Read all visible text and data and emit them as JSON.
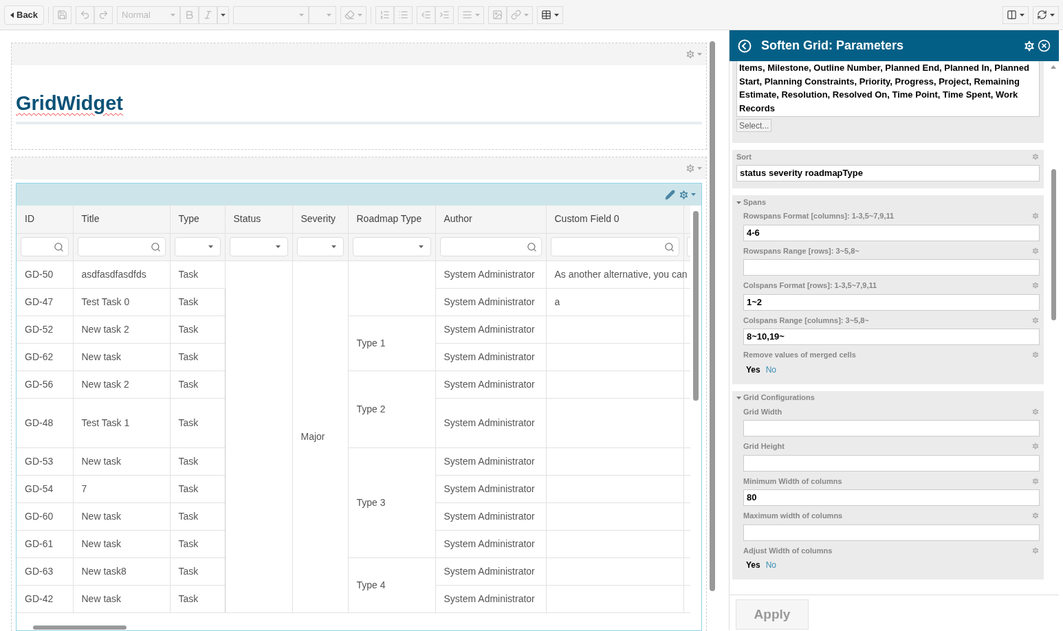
{
  "toolbar": {
    "back": "Back",
    "style": "Normal",
    "formatting_disabled": true
  },
  "title_widget": {
    "title": "GridWidget"
  },
  "grid": {
    "columns": [
      {
        "label": "ID",
        "kind": "search"
      },
      {
        "label": "Title",
        "kind": "search"
      },
      {
        "label": "Type",
        "kind": "select"
      },
      {
        "label": "Status",
        "kind": "select"
      },
      {
        "label": "Severity",
        "kind": "select"
      },
      {
        "label": "Roadmap Type",
        "kind": "select"
      },
      {
        "label": "Author",
        "kind": "search"
      },
      {
        "label": "Custom Field 0",
        "kind": "search"
      }
    ],
    "severity": "Major",
    "roadmap_groups": [
      {
        "rows": [
          {
            "id": "GD-50",
            "title": "asdfasdfasdfds",
            "type": "Task",
            "author": "System Administrator",
            "custom_field": "As another alternative, you can"
          },
          {
            "id": "GD-47",
            "title": "Test Task 0",
            "type": "Task",
            "author": "System Administrator",
            "custom_field": "a"
          }
        ]
      },
      {
        "roadmap_type": "Type 1",
        "rows": [
          {
            "id": "GD-52",
            "title": "New task 2",
            "type": "Task",
            "author": "System Administrator"
          },
          {
            "id": "GD-62",
            "title": "New task",
            "type": "Task",
            "author": "System Administrator"
          }
        ]
      },
      {
        "roadmap_type": "Type 2",
        "rows": [
          {
            "id": "GD-56",
            "title": "New task 2",
            "type": "Task",
            "author": "System Administrator"
          },
          {
            "id": "GD-48",
            "title": "Test Task 1",
            "type": "Task",
            "author": "System Administrator",
            "tall": true
          }
        ]
      },
      {
        "roadmap_type": "Type 3",
        "rows": [
          {
            "id": "GD-53",
            "title": "New task",
            "type": "Task",
            "author": "System Administrator"
          },
          {
            "id": "GD-54",
            "title": "7",
            "type": "Task",
            "author": "System Administrator"
          },
          {
            "id": "GD-60",
            "title": "New task",
            "type": "Task",
            "author": "System Administrator"
          },
          {
            "id": "GD-61",
            "title": "New task",
            "type": "Task",
            "author": "System Administrator"
          }
        ]
      },
      {
        "roadmap_type": "Type 4",
        "rows": [
          {
            "id": "GD-63",
            "title": "New task8",
            "type": "Task",
            "author": "System Administrator"
          },
          {
            "id": "GD-42",
            "title": "New task",
            "type": "Task",
            "author": "System Administrator"
          }
        ]
      }
    ]
  },
  "panel": {
    "title": "Soften Grid: Parameters",
    "columns_box": {
      "text": "Items, Milestone, Outline Number, Planned End, Planned In, Planned Start, Planning Constraints, Priority, Progress, Project, Remaining Estimate, Resolution, Resolved On, Time Point, Time Spent, Work Records",
      "button": "Select..."
    },
    "sort": {
      "label": "Sort",
      "value": "status severity roadmapType"
    },
    "groups": [
      {
        "title": "Spans",
        "expanded": true,
        "fields": [
          {
            "kind": "text",
            "label": "Rowspans Format [columns]: 1-3,5~7,9,11",
            "value": "4-6"
          },
          {
            "kind": "text",
            "label": "Rowspans Range [rows]: 3~5,8~"
          },
          {
            "kind": "text",
            "label": "Colspans Format [rows]: 1-3,5~7,9,11",
            "value": "1~2"
          },
          {
            "kind": "text",
            "label": "Colspans Range [columns]: 3~5,8~",
            "value": "8~10,19~"
          },
          {
            "kind": "toggle",
            "label": "Remove values of merged cells",
            "options": [
              {
                "label": "Yes",
                "selected": true
              },
              {
                "label": "No",
                "selected": false
              }
            ]
          }
        ]
      },
      {
        "title": "Grid Configurations",
        "expanded": true,
        "fields": [
          {
            "kind": "text",
            "label": "Grid Width"
          },
          {
            "kind": "text",
            "label": "Grid Height"
          },
          {
            "kind": "text",
            "label": "Minimum Width of columns",
            "value": "80"
          },
          {
            "kind": "text",
            "label": "Maximum width of columns"
          },
          {
            "kind": "toggle",
            "label": "Adjust Width of columns",
            "options": [
              {
                "label": "Yes",
                "selected": true
              },
              {
                "label": "No",
                "selected": false
              }
            ]
          }
        ]
      }
    ],
    "apply": {
      "label": "Apply",
      "disabled": true
    }
  }
}
